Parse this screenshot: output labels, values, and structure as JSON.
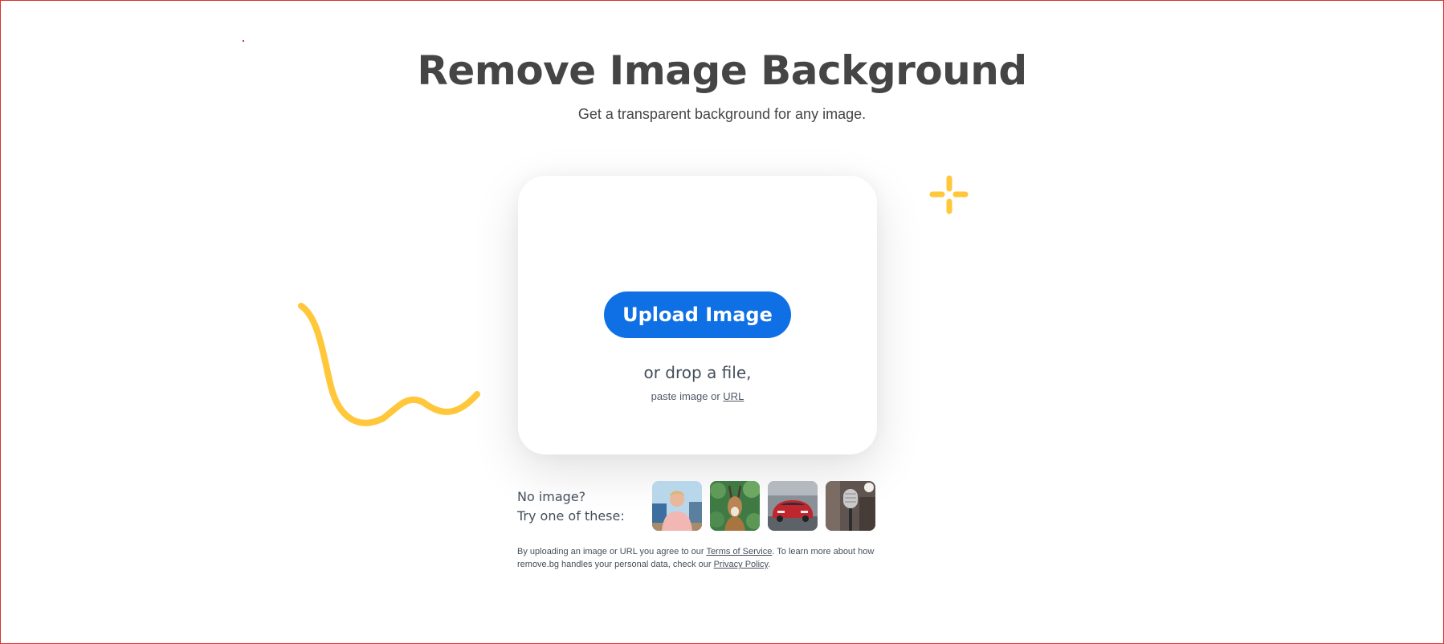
{
  "hero": {
    "title": "Remove Image Background",
    "subtitle": "Get a transparent background for any image."
  },
  "upload": {
    "button_label": "Upload Image",
    "drop_text": "or drop a file,",
    "paste_prefix": "paste image or",
    "url_label": "URL"
  },
  "samples": {
    "prompt_line1": "No image?",
    "prompt_line2": "Try one of these:",
    "items": [
      {
        "icon": "person-photo-icon"
      },
      {
        "icon": "antelope-photo-icon"
      },
      {
        "icon": "car-photo-icon"
      },
      {
        "icon": "microphone-photo-icon"
      }
    ]
  },
  "legal": {
    "part1": "By uploading an image or URL you agree to our ",
    "terms_label": "Terms of Service",
    "part2": ". To learn more about how remove.bg handles your personal data, check our ",
    "privacy_label": "Privacy Policy",
    "part3": "."
  },
  "colors": {
    "accent": "#0f70e6",
    "decoration": "#ffc739",
    "title": "#454545",
    "border": "#d9342b"
  }
}
